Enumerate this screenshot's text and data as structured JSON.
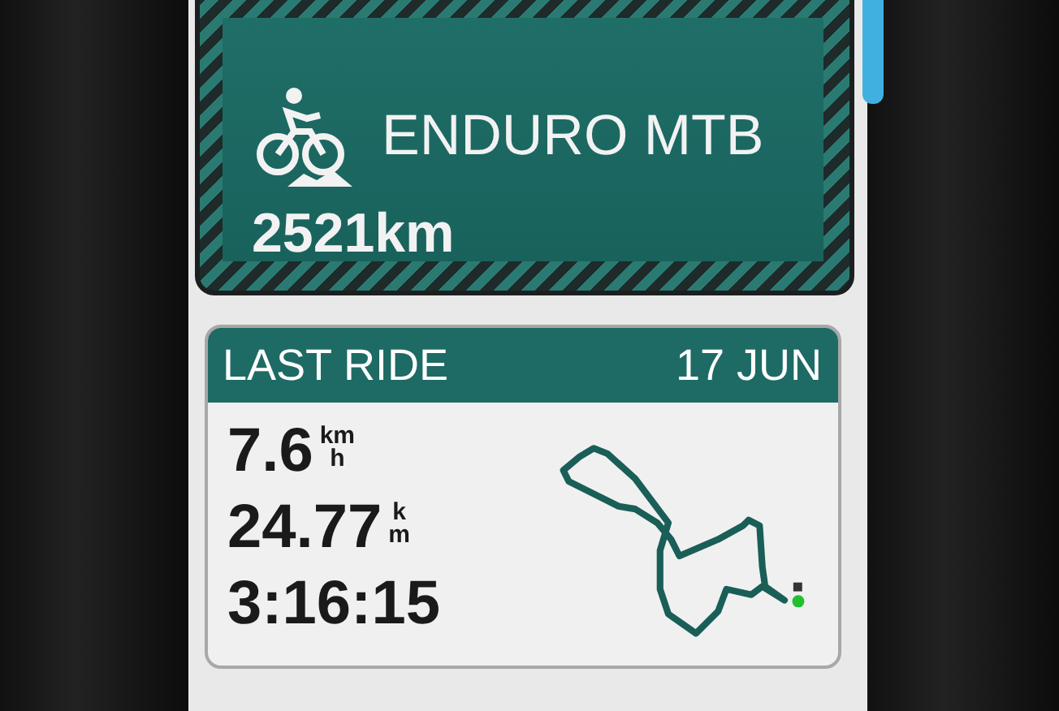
{
  "profile": {
    "name": "ENDURO MTB",
    "distance": "2521km"
  },
  "last_ride": {
    "title": "LAST RIDE",
    "date": "17 JUN",
    "stats": [
      {
        "value": "7.6",
        "unit_top": "km",
        "unit_bottom": "h"
      },
      {
        "value": "24.77",
        "unit_top": "k",
        "unit_bottom": "m"
      },
      {
        "value": "3:16:15"
      }
    ]
  }
}
